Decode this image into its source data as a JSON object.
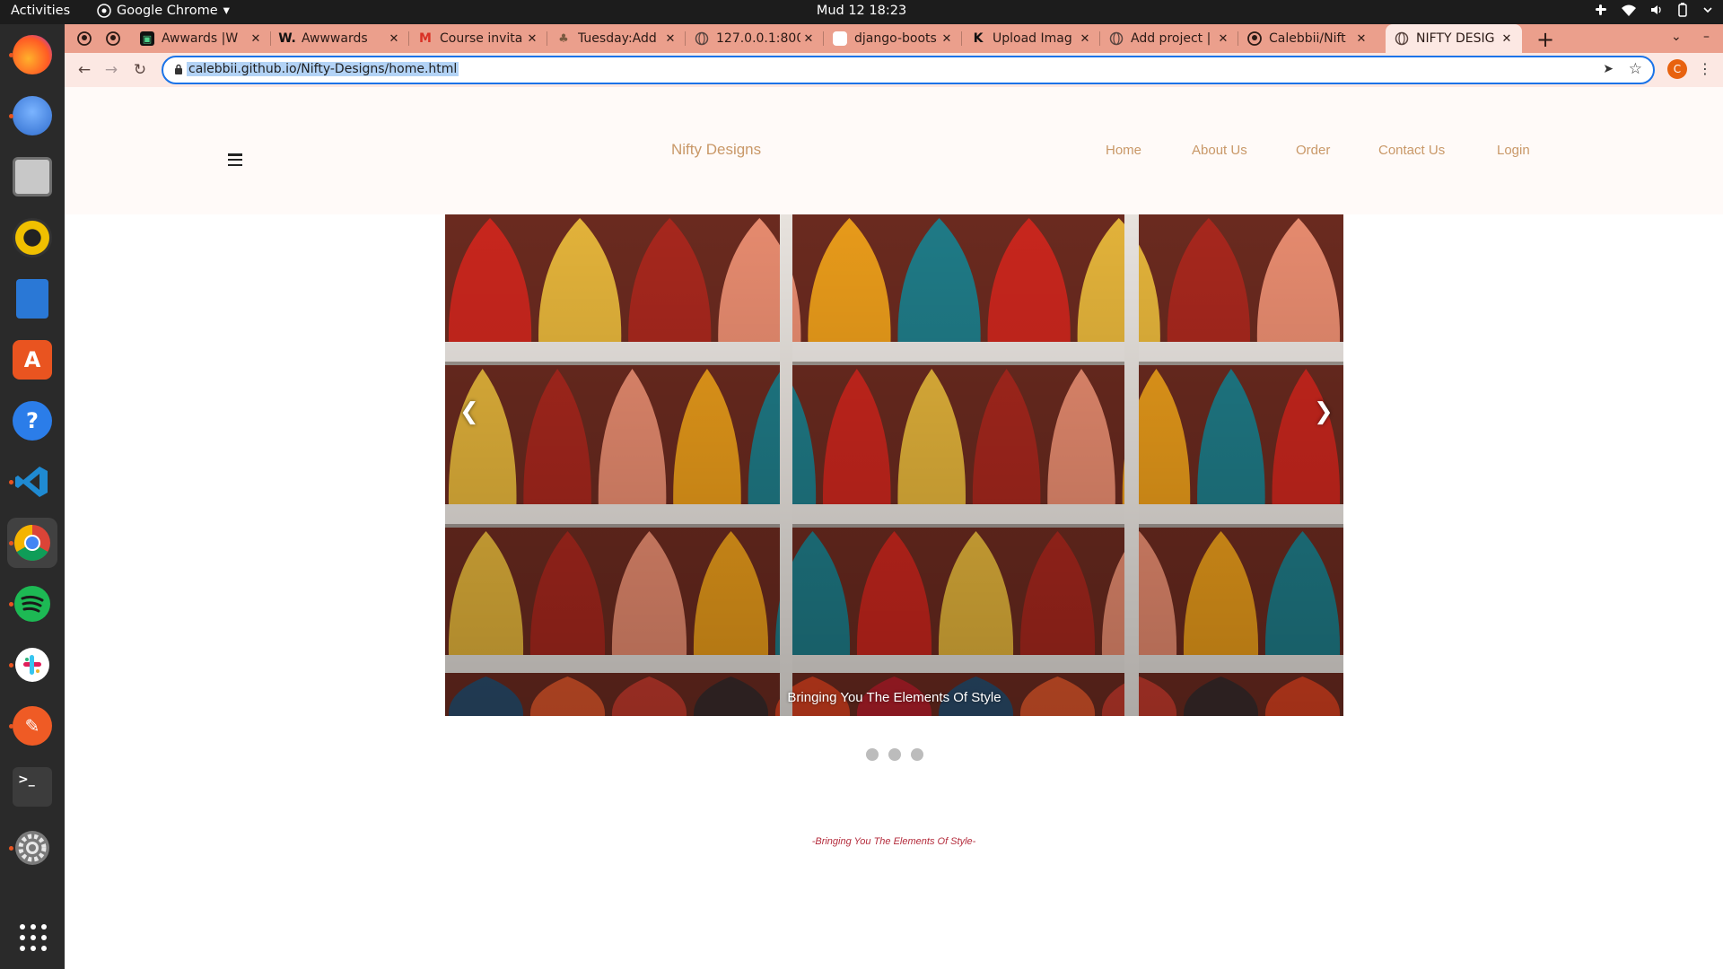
{
  "topbar": {
    "activities": "Activities",
    "app_name": "Google Chrome",
    "clock": "Mud 12  18:23",
    "tray_icons": [
      "slack-tray-icon",
      "wifi-icon",
      "volume-icon",
      "battery-icon",
      "power-menu-icon"
    ]
  },
  "dock": {
    "items": [
      {
        "name": "firefox",
        "color": "#ff7139"
      },
      {
        "name": "thunderbird",
        "color": "#2f6cce"
      },
      {
        "name": "files",
        "color": "#9b9b9b"
      },
      {
        "name": "rhythmbox",
        "color": "#f0c000"
      },
      {
        "name": "libreoffice-writer",
        "color": "#2a78d6"
      },
      {
        "name": "ubuntu-software",
        "color": "#e95420"
      },
      {
        "name": "help",
        "color": "#2b7de9"
      },
      {
        "name": "vscode",
        "color": "#1f8ad2"
      },
      {
        "name": "chrome",
        "color": "#4285f4"
      },
      {
        "name": "spotify",
        "color": "#1db954"
      },
      {
        "name": "slack",
        "color": "#ffffff"
      },
      {
        "name": "postman",
        "color": "#ef5b25"
      },
      {
        "name": "terminal",
        "color": "#3c3c3c"
      },
      {
        "name": "settings",
        "color": "#7a7a7a"
      }
    ]
  },
  "browser": {
    "tabs": [
      {
        "title": "",
        "icon": "github-icon"
      },
      {
        "title": "",
        "icon": "github-icon"
      },
      {
        "title": "Awwards |W",
        "icon": "awwards-icon"
      },
      {
        "title": "Awwwards",
        "icon": "awwwards-w-icon"
      },
      {
        "title": "Course invita",
        "icon": "gmail-icon"
      },
      {
        "title": "Tuesday:Add",
        "icon": "tree-icon"
      },
      {
        "title": "127.0.0.1:800",
        "icon": "globe-icon"
      },
      {
        "title": "django-boots",
        "icon": "doc-icon"
      },
      {
        "title": "Upload Imag",
        "icon": "k-icon"
      },
      {
        "title": "Add project |",
        "icon": "globe-icon"
      },
      {
        "title": "Calebbii/Nift",
        "icon": "github-icon"
      },
      {
        "title": "NIFTY DESIG",
        "icon": "globe-icon"
      }
    ],
    "url": "calebbii.github.io/Nifty-Designs/home.html",
    "profile_initial": "C"
  },
  "site": {
    "brand": "Nifty Designs",
    "nav": [
      "Home",
      "About Us",
      "Order",
      "Contact Us",
      "Login"
    ],
    "carousel": {
      "caption": "Bringing You The Elements Of Style",
      "prev_label": "❮",
      "next_label": "❯",
      "slide_count": 3
    },
    "tagline": "-Bringing You The Elements Of Style-"
  },
  "colors": {
    "tabstrip": "#eb9f8c",
    "toolbar": "#fce8e3",
    "nav_text": "#c99868",
    "tagline": "#b42c3c"
  }
}
